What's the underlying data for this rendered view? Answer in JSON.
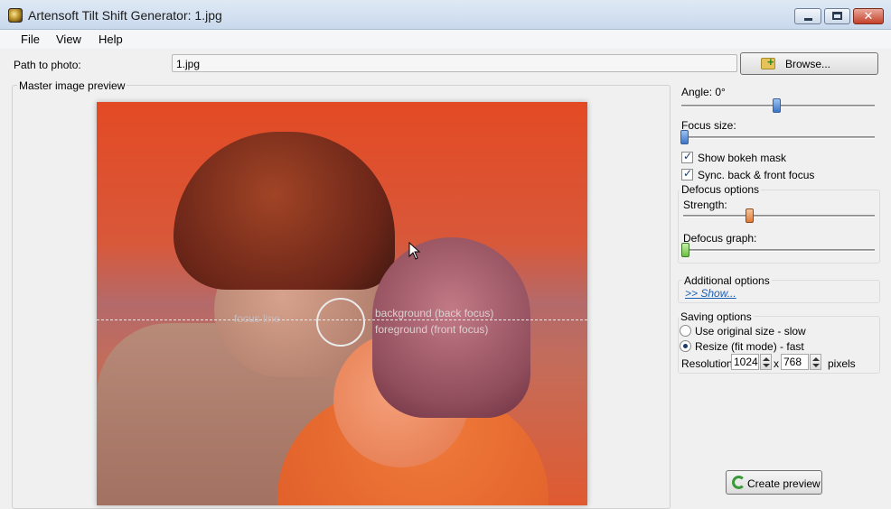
{
  "window": {
    "title": "Artensoft Tilt Shift Generator: 1.jpg",
    "close_glyph": "✕"
  },
  "menu": {
    "file": "File",
    "view": "View",
    "help": "Help"
  },
  "path": {
    "label": "Path to photo:",
    "value": "1.jpg",
    "browse_label": "Browse..."
  },
  "preview": {
    "caption": "Master image preview",
    "focus_label": "focus line",
    "back_label": "background (back focus)",
    "front_label": "foreground (front focus)"
  },
  "controls": {
    "angle_label": "Angle: 0°",
    "angle_value": 0.5,
    "focus_size_label": "Focus size:",
    "focus_size_value": 0,
    "show_bokeh_label": "Show bokeh mask",
    "show_bokeh_checked": true,
    "sync_label": "Sync. back & front focus",
    "sync_checked": true,
    "defocus": {
      "caption": "Defocus options",
      "strength_label": "Strength:",
      "strength_value": 0.33,
      "graph_label": "Defocus graph:",
      "graph_value": 0
    },
    "additional": {
      "caption": "Additional options",
      "show_link": ">> Show..."
    },
    "saving": {
      "caption": "Saving options",
      "original_label": "Use original size - slow",
      "resize_label": "Resize (fit mode) - fast",
      "selected": "resize",
      "resolution_label": "Resolution",
      "width": "1024",
      "x_label": "x",
      "height": "768",
      "pixels_label": "pixels"
    },
    "create_label": "Create preview"
  },
  "colors": {
    "accent": "#3b74c8",
    "link": "#1a5fb4",
    "close_btn": "#c4402a"
  }
}
